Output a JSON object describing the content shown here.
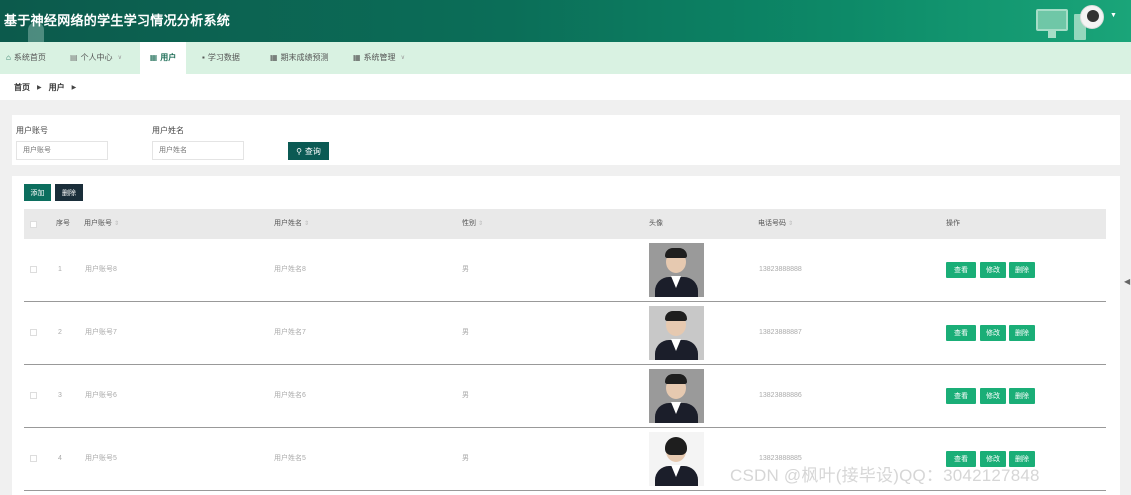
{
  "header": {
    "title": "基于神经网络的学生学习情况分析系统",
    "avatar_icon": "user-avatar-icon"
  },
  "nav": {
    "items": [
      {
        "label": "系统首页",
        "icon": "home-icon"
      },
      {
        "label": "个人中心",
        "icon": "profile-icon"
      },
      {
        "label": "用户",
        "icon": "grid-icon"
      },
      {
        "label": "学习数据",
        "icon": "chat-icon"
      },
      {
        "label": "期末成绩预测",
        "icon": "grid-icon"
      },
      {
        "label": "系统管理",
        "icon": "grid-icon"
      }
    ]
  },
  "breadcrumb": {
    "home": "首页",
    "current": "用户"
  },
  "search": {
    "account_label": "用户账号",
    "account_placeholder": "用户账号",
    "name_label": "用户姓名",
    "name_placeholder": "用户姓名",
    "button": "查询"
  },
  "toolbar": {
    "add": "添加",
    "delete": "删除"
  },
  "table": {
    "columns": {
      "index": "序号",
      "account": "用户账号",
      "name": "用户姓名",
      "gender": "性别",
      "avatar": "头像",
      "phone": "电话号码",
      "ops": "操作"
    },
    "rows": [
      {
        "index": "1",
        "account": "用户账号8",
        "name": "用户姓名8",
        "gender": "男",
        "phone": "13823888888"
      },
      {
        "index": "2",
        "account": "用户账号7",
        "name": "用户姓名7",
        "gender": "男",
        "phone": "13823888887"
      },
      {
        "index": "3",
        "account": "用户账号6",
        "name": "用户姓名6",
        "gender": "男",
        "phone": "13823888886"
      },
      {
        "index": "4",
        "account": "用户账号5",
        "name": "用户姓名5",
        "gender": "男",
        "phone": "13823888885"
      }
    ],
    "actions": {
      "view": "查看",
      "edit": "修改",
      "delete": "删除"
    }
  },
  "watermark": "CSDN @枫叶(接毕设)QQ：3042127848",
  "colors": {
    "header_dark": "#0c5a4c",
    "nav_bg": "#d9f2e2",
    "action_green": "#1aae77",
    "search_btn": "#0b5a54"
  }
}
